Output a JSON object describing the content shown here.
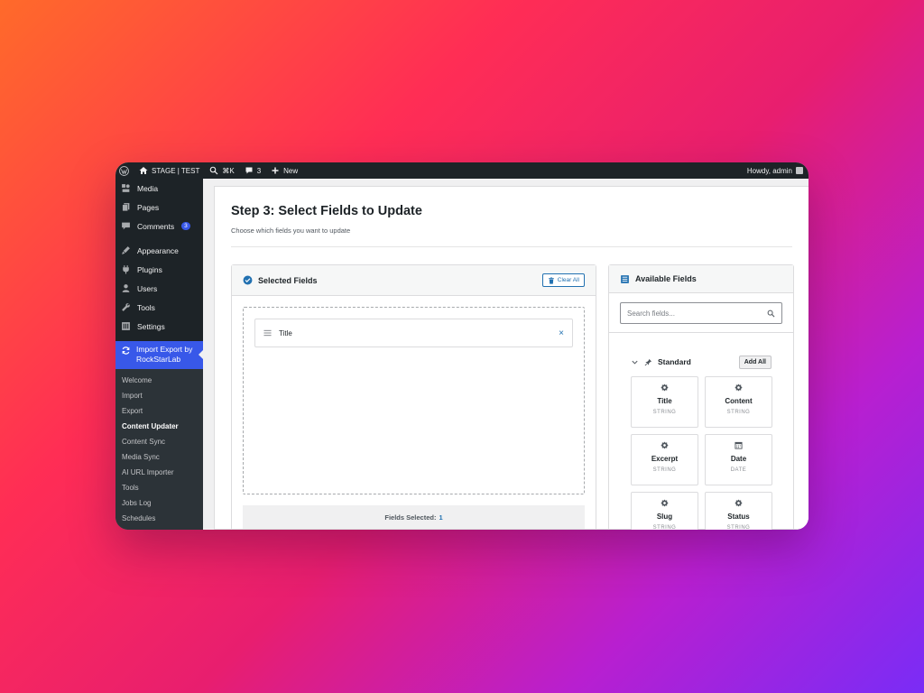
{
  "adminbar": {
    "site_name": "STAGE | TEST",
    "shortcut": "⌘K",
    "comments_count": "3",
    "new_label": "New",
    "greeting": "Howdy, admin"
  },
  "sidebar": {
    "items": [
      {
        "label": "Media",
        "icon": "media-icon"
      },
      {
        "label": "Pages",
        "icon": "pages-icon"
      },
      {
        "label": "Comments",
        "icon": "comments-icon",
        "badge": "3"
      },
      {
        "label": "Appearance",
        "icon": "appearance-icon"
      },
      {
        "label": "Plugins",
        "icon": "plugins-icon"
      },
      {
        "label": "Users",
        "icon": "users-icon"
      },
      {
        "label": "Tools",
        "icon": "tools-icon"
      },
      {
        "label": "Settings",
        "icon": "settings-icon"
      }
    ],
    "current": {
      "line1": "Import Export by",
      "line2": "RockStarLab"
    },
    "submenu": [
      "Welcome",
      "Import",
      "Export",
      "Content Updater",
      "Content Sync",
      "Media Sync",
      "AI URL Importer",
      "Tools",
      "Jobs Log",
      "Schedules"
    ],
    "active_submenu": "Content Updater"
  },
  "main": {
    "title": "Step 3: Select Fields to Update",
    "subtitle": "Choose which fields you want to update"
  },
  "selected_panel": {
    "title": "Selected Fields",
    "clear_label": "Clear All",
    "fields": [
      {
        "label": "Title"
      }
    ],
    "count_label": "Fields Selected:",
    "count": "1"
  },
  "available_panel": {
    "title": "Available Fields",
    "search_placeholder": "Search fields...",
    "group": {
      "label": "Standard",
      "add_all_label": "Add All"
    },
    "fields": [
      {
        "name": "Title",
        "type": "STRING",
        "icon": "gear-icon"
      },
      {
        "name": "Content",
        "type": "STRING",
        "icon": "gear-icon"
      },
      {
        "name": "Excerpt",
        "type": "STRING",
        "icon": "gear-icon"
      },
      {
        "name": "Date",
        "type": "DATE",
        "icon": "calendar-icon"
      },
      {
        "name": "Slug",
        "type": "STRING",
        "icon": "gear-icon"
      },
      {
        "name": "Status",
        "type": "STRING",
        "icon": "gear-icon"
      }
    ]
  },
  "colors": {
    "admin_dark": "#1d2327",
    "accent_blue": "#3858e9",
    "link_blue": "#2271b1"
  }
}
